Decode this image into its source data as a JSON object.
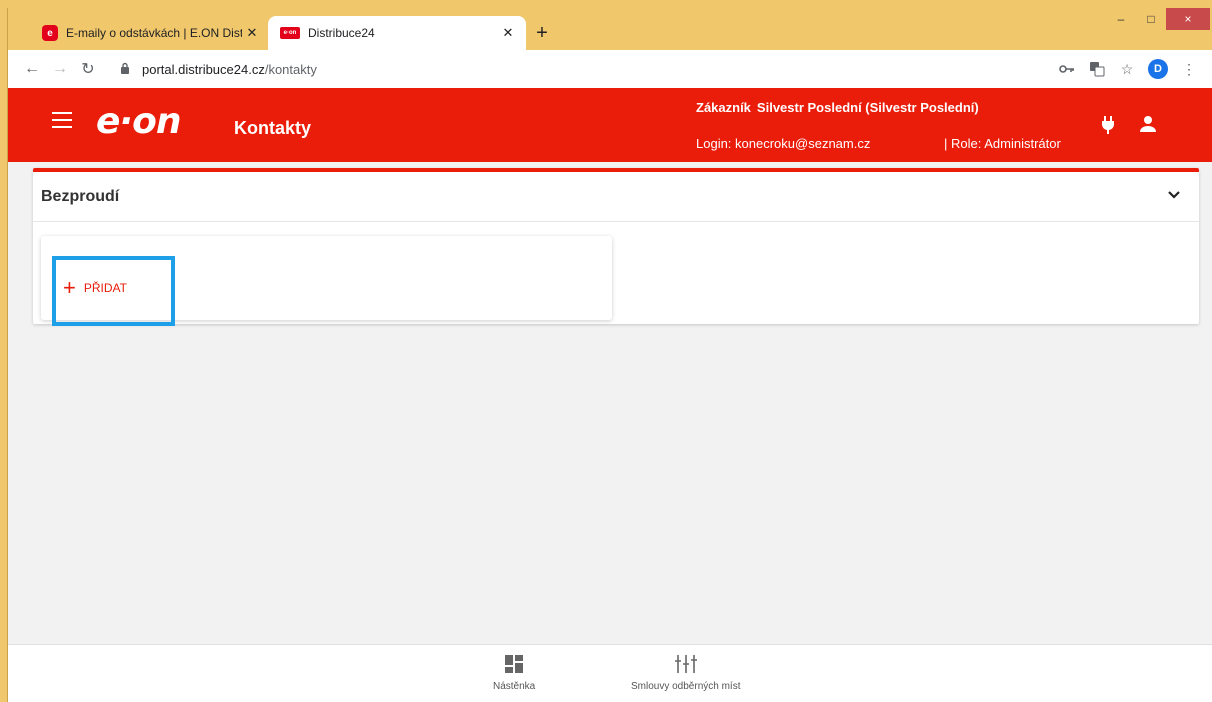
{
  "browser": {
    "tabs": [
      {
        "title": "E-maily o odstávkách | E.ON Dist",
        "active": false
      },
      {
        "title": "Distribuce24",
        "active": true
      }
    ],
    "url_host": "portal.distribuce24.cz",
    "url_path": "/kontakty",
    "profile_initial": "D",
    "window_controls": [
      "–",
      "□",
      "×"
    ]
  },
  "header": {
    "logo_text": "e·on",
    "page_title": "Kontakty",
    "customer_label": "Zákazník",
    "customer_name": "Silvestr Poslední (Silvestr Poslední)",
    "login_text": "Login: konecroku@seznam.cz",
    "role_text": "| Role: Administrátor",
    "brand_color": "#ea1c0a"
  },
  "main": {
    "card_title": "Bezproudí",
    "add_button_label": "PŘIDAT"
  },
  "bottom_nav": [
    {
      "label": "Nástěnka",
      "icon": "dashboard-icon"
    },
    {
      "label": "Smlouvy odběrných míst",
      "icon": "meters-icon"
    }
  ],
  "highlight_color": "#1ea0e8"
}
